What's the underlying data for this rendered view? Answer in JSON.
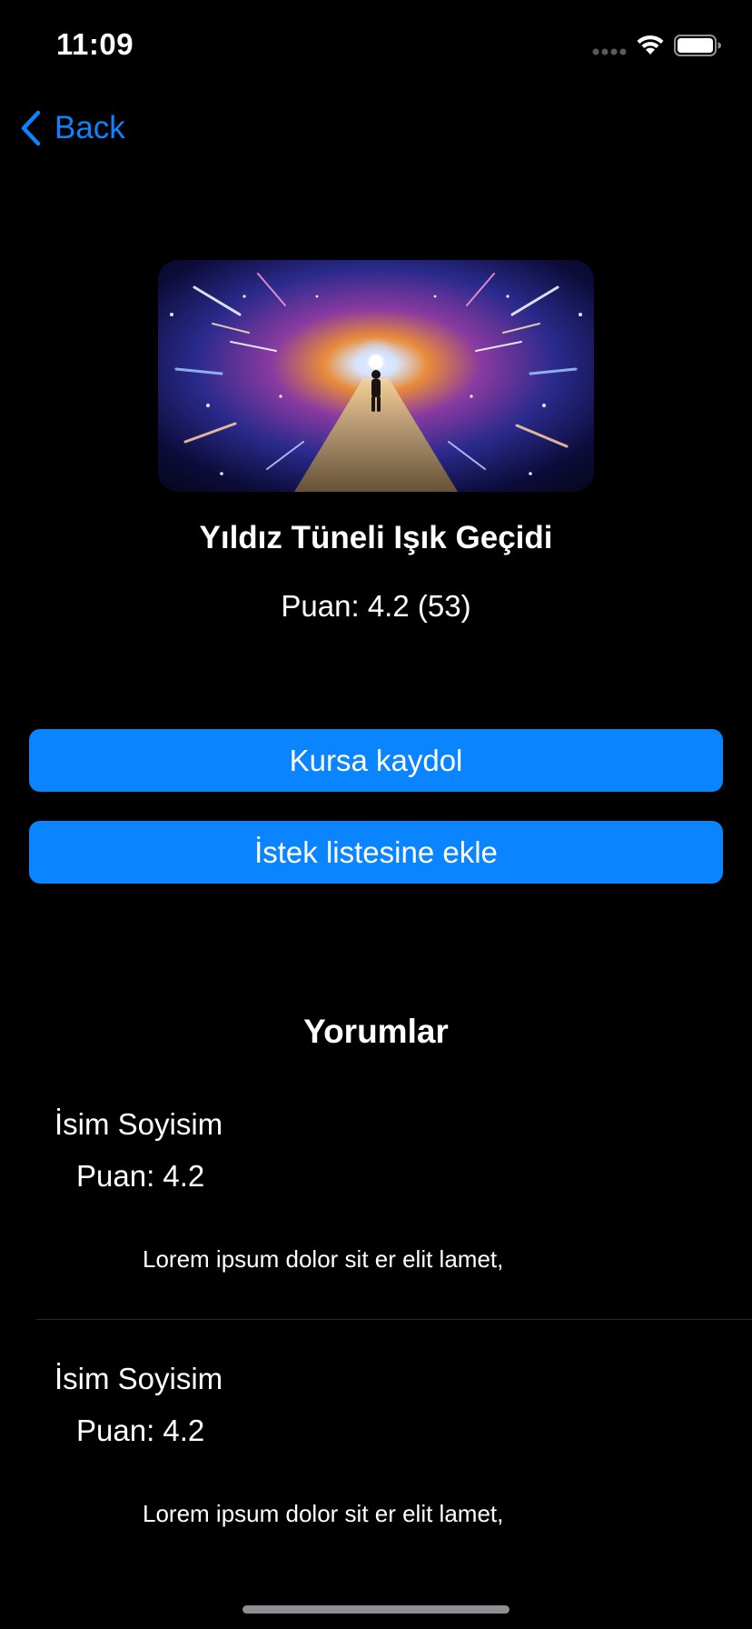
{
  "status_bar": {
    "time": "11:09"
  },
  "nav": {
    "back_label": "Back"
  },
  "course": {
    "title": "Yıldız Tüneli Işık Geçidi",
    "rating_text": "Puan: 4.2 (53)"
  },
  "actions": {
    "enroll_label": "Kursa kaydol",
    "wishlist_label": "İstek listesine ekle"
  },
  "reviews": {
    "title": "Yorumlar",
    "items": [
      {
        "name": "İsim Soyisim",
        "rating": "Puan: 4.2",
        "text": "Lorem ipsum dolor sit er elit lamet,"
      },
      {
        "name": "İsim Soyisim",
        "rating": "Puan: 4.2",
        "text": "Lorem ipsum dolor sit er elit lamet,"
      }
    ]
  },
  "colors": {
    "background": "#000000",
    "accent": "#0a84ff",
    "text": "#ffffff",
    "divider": "#2c2c2e"
  },
  "icons": [
    "back-chevron-icon",
    "cellular-dots-icon",
    "wifi-icon",
    "battery-icon"
  ]
}
